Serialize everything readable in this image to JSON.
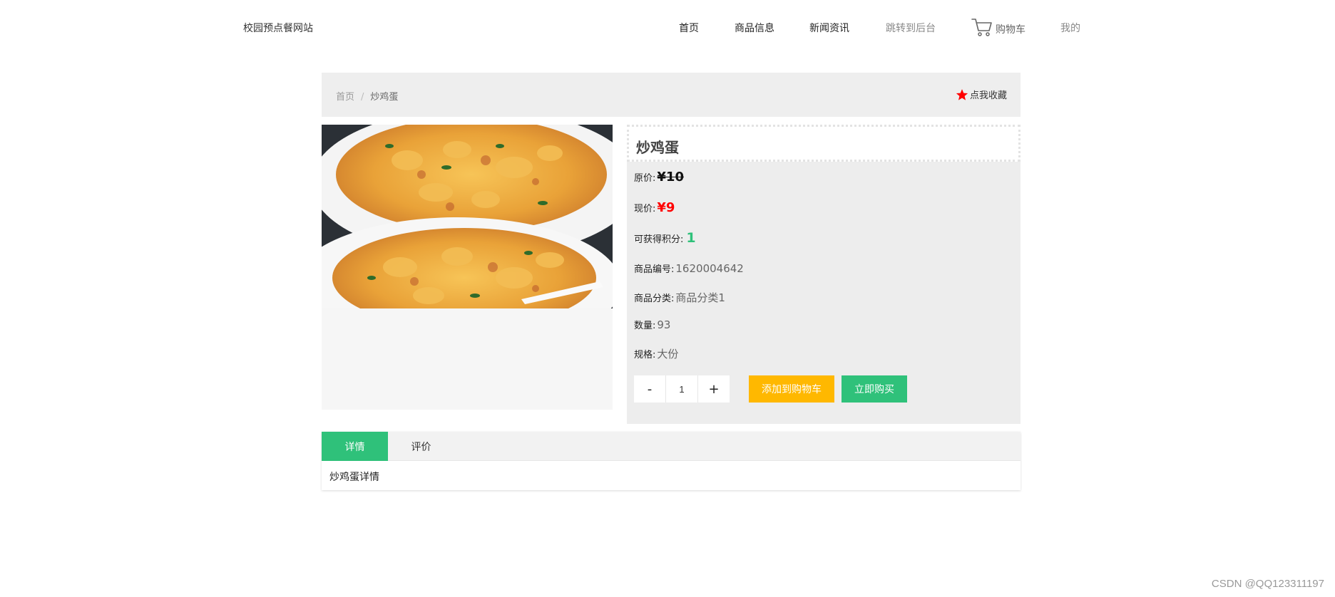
{
  "header": {
    "site_title": "校园预点餐网站",
    "nav": {
      "home": "首页",
      "products": "商品信息",
      "news": "新闻资讯",
      "admin": "跳转到后台",
      "cart": "购物车",
      "mine": "我的"
    },
    "cart_icon": "shopping-cart-icon"
  },
  "breadcrumb": {
    "home": "首页",
    "separator": "/",
    "current": "炒鸡蛋"
  },
  "favorite": {
    "label": "点我收藏",
    "icon": "star-icon",
    "icon_color": "#ff0000"
  },
  "product": {
    "name": "炒鸡蛋",
    "original_price_label": "原价:",
    "original_price": "¥10",
    "current_price_label": "现价:",
    "current_price": "¥9",
    "points_label": "可获得积分:",
    "points": "1",
    "code_label": "商品编号:",
    "code": "1620004642",
    "category_label": "商品分类:",
    "category": "商品分类1",
    "quantity_label": "数量:",
    "quantity": "93",
    "spec_label": "规格:",
    "spec": "大份"
  },
  "purchase": {
    "minus": "-",
    "qty_value": "1",
    "plus": "+",
    "add_to_cart": "添加到购物车",
    "buy_now": "立即购买"
  },
  "tabs": {
    "items": [
      {
        "label": "详情",
        "active": true
      },
      {
        "label": "评价",
        "active": false
      }
    ],
    "content": "炒鸡蛋详情"
  },
  "colors": {
    "accent_green": "#2fc17a",
    "accent_yellow": "#ffb800",
    "price_red": "#ff0000"
  },
  "watermark": "CSDN @QQ123311197"
}
